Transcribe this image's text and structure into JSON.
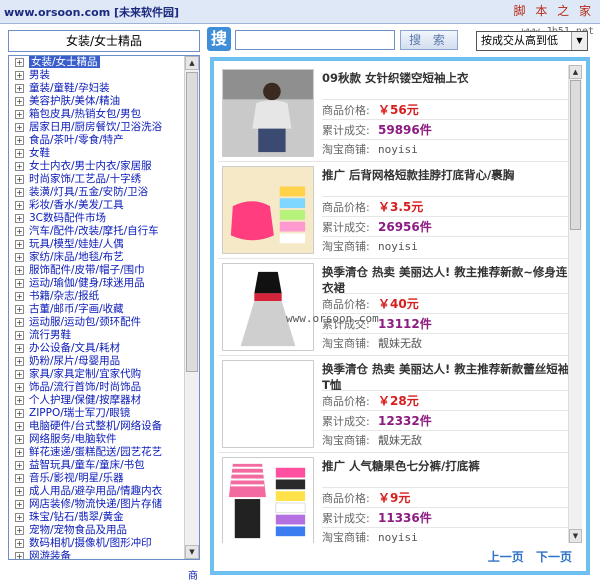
{
  "window": {
    "title": "www.orsoon.com [未来软件园]",
    "watermark": "脚 本 之 家",
    "watermark_url": "www.Jb51.net"
  },
  "category_header": "女装/女士精品",
  "search": {
    "icon_char": "搜",
    "input_value": "",
    "button_label": "搜 索",
    "sort_selected": "按成交从高到低"
  },
  "categories": [
    "女装/女士精品",
    "男装",
    "童装/童鞋/孕妇装",
    "美容护肤/美体/精油",
    "箱包皮具/热销女包/男包",
    "居家日用/厨房餐饮/卫浴洗浴",
    "食品/茶叶/零食/特产",
    "女鞋",
    "女士内衣/男士内衣/家居服",
    "时尚家饰/工艺品/十字绣",
    "装潢/灯具/五金/安防/卫浴",
    "彩妆/香水/美发/工具",
    "3C数码配件市场",
    "汽车/配件/改装/摩托/自行车",
    "玩具/模型/娃娃/人偶",
    "家纺/床品/地毯/布艺",
    "服饰配件/皮带/帽子/围巾",
    "运动/瑜伽/健身/球迷用品",
    "书籍/杂志/报纸",
    "古董/邮币/字画/收藏",
    "运动服/运动包/颈环配件",
    "流行男鞋",
    "办公设备/文具/耗材",
    "奶粉/尿片/母婴用品",
    "家具/家具定制/宜家代购",
    "饰品/流行首饰/时尚饰品",
    "个人护理/保健/按摩器材",
    "ZIPPO/瑞士军刀/眼镜",
    "电脑硬件/台式整机/网络设备",
    "网络服务/电脑软件",
    "鲜花速递/蛋糕配送/园艺花艺",
    "益智玩具/童车/童床/书包",
    "音乐/影视/明星/乐器",
    "成人用品/避孕用品/情趣内衣",
    "网店装修/物流快递/图片存储",
    "珠宝/钻石/翡翠/黄金",
    "宠物/宠物食品及用品",
    "数码相机/摄像机/图形冲印",
    "网游装备"
  ],
  "labels": {
    "price": "商品价格:",
    "sales": "累计成交:",
    "shop": "淘宝商铺:"
  },
  "products": [
    {
      "title": "09秋款 女针织镂空短袖上衣",
      "price": "￥56元",
      "sales": "59896件",
      "shop": "noyisi"
    },
    {
      "title": "推广 后背网格短款挂脖打底背心/裹胸",
      "price": "￥3.5元",
      "sales": "26956件",
      "shop": "noyisi"
    },
    {
      "title": "换季清仓 热卖 美丽达人! 教主推荐新款~修身连衣裙",
      "price": "￥40元",
      "sales": "13112件",
      "shop": "靓妹无敌"
    },
    {
      "title": "换季清仓 热卖 美丽达人! 教主推荐新款蕾丝短袖T恤",
      "price": "￥28元",
      "sales": "12332件",
      "shop": "靓妹无敌"
    },
    {
      "title": "推广 人气糖果色七分裤/打底裤",
      "price": "￥9元",
      "sales": "11336件",
      "shop": "noyisi"
    }
  ],
  "pager": {
    "prev": "上一页",
    "next": "下一页"
  },
  "overlay": {
    "site_mark": "www.orsoon.com",
    "corner_char": "商"
  },
  "colors": {
    "accent": "#6ec0f0",
    "price": "#d71d1d",
    "sales": "#8c1b82",
    "link": "#0a1ab8"
  }
}
